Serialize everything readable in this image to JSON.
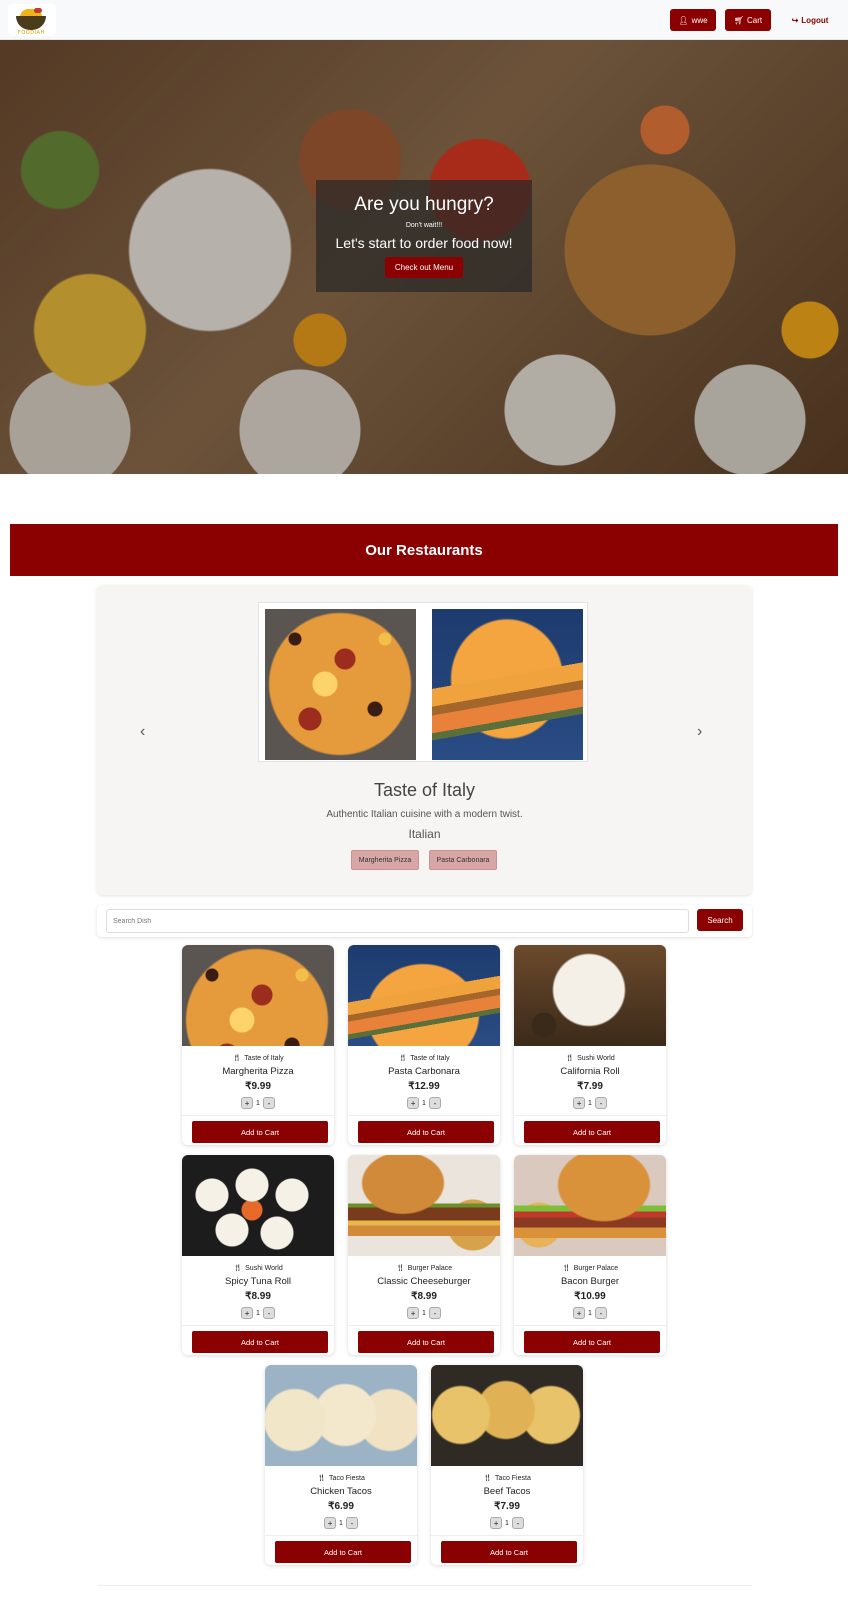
{
  "nav": {
    "logo_text": "FOODIAH",
    "user_label": "wwe",
    "cart_label": "Cart",
    "logout_label": "Logout"
  },
  "hero": {
    "title": "Are you hungry?",
    "subtitle": "Don't wait!!!",
    "tagline": "Let's start to order food now!",
    "button_label": "Check out Menu"
  },
  "restaurants": {
    "header": "Our Restaurants",
    "current": {
      "name": "Taste of Italy",
      "description": "Authentic Italian cuisine with a modern twist.",
      "cuisine": "Italian",
      "tags": [
        "Margherita Pizza",
        "Pasta Carbonara"
      ]
    },
    "prev_arrow": "‹",
    "next_arrow": "›"
  },
  "search": {
    "placeholder": "Search Dish",
    "button_label": "Search"
  },
  "dishes": [
    {
      "restaurant": "Taste of Italy",
      "name": "Margherita Pizza",
      "price": "₹9.99",
      "qty": "1"
    },
    {
      "restaurant": "Taste of Italy",
      "name": "Pasta Carbonara",
      "price": "₹12.99",
      "qty": "1"
    },
    {
      "restaurant": "Sushi World",
      "name": "California Roll",
      "price": "₹7.99",
      "qty": "1"
    },
    {
      "restaurant": "Sushi World",
      "name": "Spicy Tuna Roll",
      "price": "₹8.99",
      "qty": "1"
    },
    {
      "restaurant": "Burger Palace",
      "name": "Classic Cheeseburger",
      "price": "₹8.99",
      "qty": "1"
    },
    {
      "restaurant": "Burger Palace",
      "name": "Bacon Burger",
      "price": "₹10.99",
      "qty": "1"
    },
    {
      "restaurant": "Taco Fiesta",
      "name": "Chicken Tacos",
      "price": "₹6.99",
      "qty": "1"
    },
    {
      "restaurant": "Taco Fiesta",
      "name": "Beef Tacos",
      "price": "₹7.99",
      "qty": "1"
    }
  ],
  "card_labels": {
    "add_to_cart": "Add to Cart",
    "plus": "+",
    "minus": "-"
  },
  "colors": {
    "brand": "#8b0000",
    "tag_bg": "#d8a6a6"
  }
}
